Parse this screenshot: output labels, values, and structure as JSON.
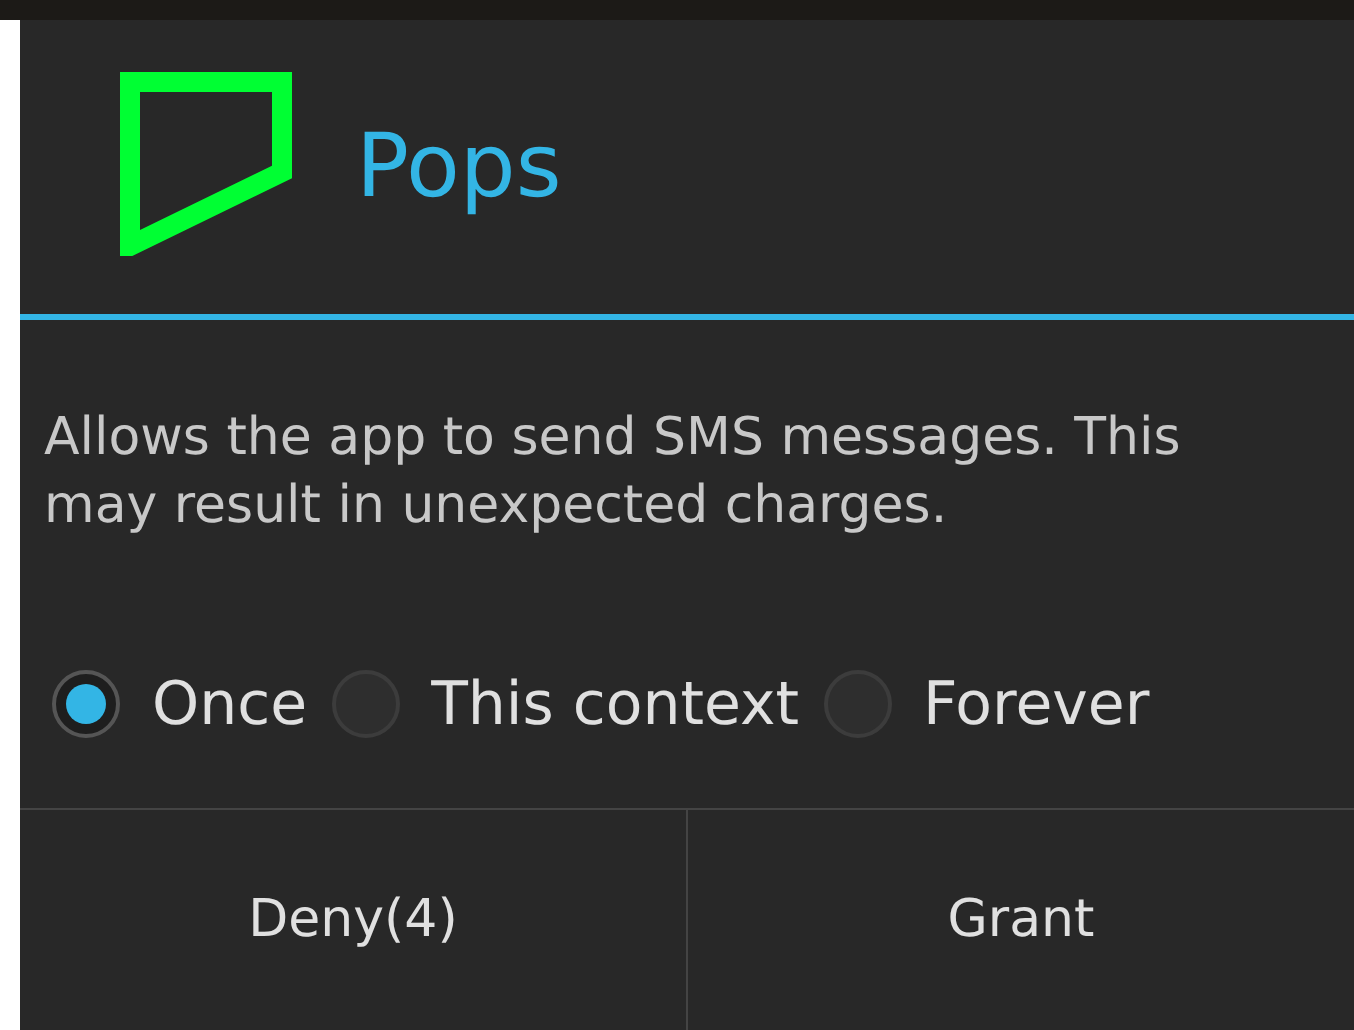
{
  "dialog": {
    "title": "Pops",
    "message": "Allows the app to send SMS messages. This may result in unexpected charges.",
    "options": [
      {
        "label": "Once",
        "selected": true
      },
      {
        "label": "This context",
        "selected": false
      },
      {
        "label": "Forever",
        "selected": false
      }
    ],
    "buttons": [
      "Deny(4)",
      "Grant"
    ]
  }
}
